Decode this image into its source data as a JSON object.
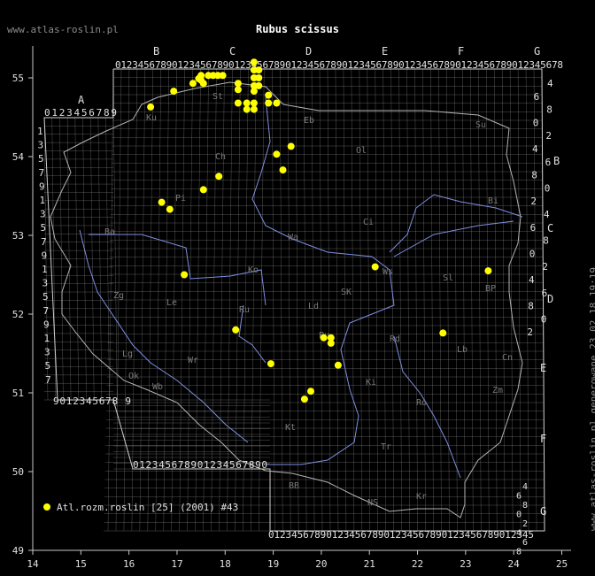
{
  "site_label": "www.atlas-roslin.pl",
  "title": "Rubus scissus",
  "side_note": "www.atlas-roslin.pl generowane 23.02.18 19:19",
  "legend": {
    "label": "Atl.rozm.roslin [25] (2001) #43",
    "marker_color": "#ffff00"
  },
  "colors": {
    "background": "#000000",
    "grid": "#9a9a9a",
    "river": "#7f8fe0",
    "border": "#c0c0c0",
    "region_label": "#7a7a7a",
    "point": "#ffff00",
    "axis_text": "#e0e0e0"
  },
  "chart_data": {
    "type": "scatter",
    "title": "Rubus scissus",
    "x_ticks": [
      "14",
      "15",
      "16",
      "17",
      "18",
      "19",
      "20",
      "21",
      "22",
      "23",
      "24",
      "25"
    ],
    "y_ticks": [
      "49",
      "50",
      "51",
      "52",
      "53",
      "54",
      "55"
    ],
    "xlim": [
      14,
      25
    ],
    "ylim": [
      49,
      55.6
    ],
    "series": [
      {
        "name": "Atl.rozm.roslin [25] (2001) #43",
        "color": "#ffff00",
        "points": [
          [
            16.45,
            54.63
          ],
          [
            16.93,
            54.83
          ],
          [
            17.33,
            54.93
          ],
          [
            17.45,
            54.99
          ],
          [
            17.5,
            55.03
          ],
          [
            17.5,
            54.97
          ],
          [
            17.55,
            54.93
          ],
          [
            17.65,
            55.03
          ],
          [
            17.75,
            55.03
          ],
          [
            17.85,
            55.03
          ],
          [
            17.95,
            55.03
          ],
          [
            18.27,
            54.93
          ],
          [
            18.27,
            54.85
          ],
          [
            18.27,
            54.68
          ],
          [
            18.45,
            54.68
          ],
          [
            18.45,
            54.6
          ],
          [
            18.6,
            54.6
          ],
          [
            18.6,
            54.68
          ],
          [
            18.6,
            55.2
          ],
          [
            18.6,
            55.1
          ],
          [
            18.6,
            55.0
          ],
          [
            18.6,
            54.9
          ],
          [
            18.7,
            55.1
          ],
          [
            18.7,
            55.0
          ],
          [
            18.7,
            54.9
          ],
          [
            18.6,
            54.83
          ],
          [
            18.9,
            54.78
          ],
          [
            18.9,
            54.68
          ],
          [
            19.07,
            54.68
          ],
          [
            19.37,
            54.13
          ],
          [
            19.07,
            54.03
          ],
          [
            19.2,
            53.83
          ],
          [
            17.87,
            53.75
          ],
          [
            17.55,
            53.58
          ],
          [
            16.68,
            53.42
          ],
          [
            16.85,
            53.33
          ],
          [
            17.15,
            52.5
          ],
          [
            21.12,
            52.6
          ],
          [
            23.47,
            52.55
          ],
          [
            18.22,
            51.8
          ],
          [
            22.53,
            51.76
          ],
          [
            20.05,
            51.7
          ],
          [
            20.2,
            51.7
          ],
          [
            20.2,
            51.63
          ],
          [
            18.95,
            51.37
          ],
          [
            20.35,
            51.35
          ],
          [
            19.78,
            51.02
          ],
          [
            19.65,
            50.92
          ]
        ]
      }
    ]
  },
  "grid_letters": {
    "top": [
      "B",
      "C",
      "D",
      "E",
      "F",
      "G"
    ],
    "left": [
      "A"
    ],
    "right": [
      "B",
      "C",
      "D",
      "E",
      "F",
      "G"
    ]
  },
  "grid_digits": {
    "top_row_b": "0123456789012345678901234567890123456789012345678901234567890123456789012345678",
    "row_a": "0123456789",
    "bottom_left": "9012345678 9",
    "bottom_b": "012345678901234567890",
    "bottom_main": "0123456789012345678901234567890123456789012345",
    "left_col": [
      "1",
      "3",
      "5",
      "7",
      "9",
      "1",
      "3",
      "5",
      "7",
      "9",
      "1",
      "3",
      "5",
      "7",
      "9",
      "1",
      "3",
      "5",
      "7"
    ],
    "right_col": [
      "4",
      "6",
      "8",
      "0",
      "2",
      "4",
      "6",
      "8",
      "0",
      "2",
      "4",
      "6",
      "8",
      "0",
      "2",
      "4",
      "6",
      "8",
      "0",
      "2"
    ],
    "right_col_low": [
      "4",
      "6",
      "8",
      "0",
      "2",
      "4",
      "6",
      "8"
    ]
  },
  "regions": [
    "Ku",
    "St",
    "Eb",
    "Su",
    "Ch",
    "Ol",
    "Pi",
    "Bi",
    "Ci",
    "Ba",
    "Wa",
    "Ko",
    "Sl",
    "Ws",
    "BP",
    "Zg",
    "Le",
    "Ld",
    "SK",
    "Ru",
    "Pu",
    "Rd",
    "Lb",
    "Cn",
    "Lg",
    "Wr",
    "Wb",
    "Ok",
    "Zm",
    "Kt",
    "Ro",
    "Tr",
    "Ki",
    "BB",
    "NS",
    "Kr"
  ]
}
